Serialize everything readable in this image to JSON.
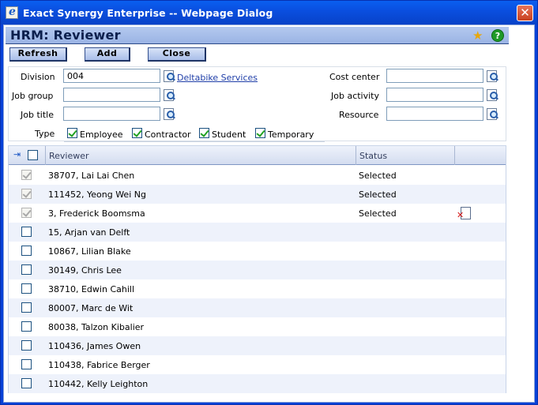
{
  "window": {
    "title": "Exact Synergy Enterprise -- Webpage Dialog",
    "close_glyph": "✕"
  },
  "header": {
    "title": "HRM: Reviewer",
    "icons": [
      "favorite-star-icon",
      "help-icon"
    ],
    "help_glyph": "?",
    "fav_glyph": "★"
  },
  "toolbar": {
    "refresh_label": "Refresh",
    "add_label": "Add",
    "close_label": "Close"
  },
  "filters": {
    "division_label": "Division",
    "division_value": "004",
    "division_link": "Deltabike Services",
    "job_group_label": "Job group",
    "job_group_value": "",
    "job_title_label": "Job title",
    "job_title_value": "",
    "cost_center_label": "Cost center",
    "cost_center_value": "",
    "job_activity_label": "Job activity",
    "job_activity_value": "",
    "resource_label": "Resource",
    "resource_value": "",
    "type_label": "Type",
    "types": [
      {
        "label": "Employee",
        "checked": true
      },
      {
        "label": "Contractor",
        "checked": true
      },
      {
        "label": "Student",
        "checked": true
      },
      {
        "label": "Temporary",
        "checked": true
      }
    ]
  },
  "grid": {
    "columns": {
      "reviewer": "Reviewer",
      "status": "Status"
    },
    "pin_glyph": "⇥",
    "rows": [
      {
        "reviewer": "38707, Lai Lai Chen",
        "status": "Selected",
        "checked": true,
        "disabled": true,
        "delete": false
      },
      {
        "reviewer": "111452, Yeong Wei Ng",
        "status": "Selected",
        "checked": true,
        "disabled": true,
        "delete": false
      },
      {
        "reviewer": "3, Frederick Boomsma",
        "status": "Selected",
        "checked": true,
        "disabled": true,
        "delete": true
      },
      {
        "reviewer": "15, Arjan van Delft",
        "status": "",
        "checked": false,
        "disabled": false,
        "delete": false
      },
      {
        "reviewer": "10867, Lilian Blake",
        "status": "",
        "checked": false,
        "disabled": false,
        "delete": false
      },
      {
        "reviewer": "30149, Chris Lee",
        "status": "",
        "checked": false,
        "disabled": false,
        "delete": false
      },
      {
        "reviewer": "38710, Edwin Cahill",
        "status": "",
        "checked": false,
        "disabled": false,
        "delete": false
      },
      {
        "reviewer": "80007, Marc de Wit",
        "status": "",
        "checked": false,
        "disabled": false,
        "delete": false
      },
      {
        "reviewer": "80038, Talzon Kibalier",
        "status": "",
        "checked": false,
        "disabled": false,
        "delete": false
      },
      {
        "reviewer": "110436, James Owen",
        "status": "",
        "checked": false,
        "disabled": false,
        "delete": false
      },
      {
        "reviewer": "110438, Fabrice Berger",
        "status": "",
        "checked": false,
        "disabled": false,
        "delete": false
      },
      {
        "reviewer": "110442, Kelly Leighton",
        "status": "",
        "checked": false,
        "disabled": false,
        "delete": false
      }
    ]
  }
}
